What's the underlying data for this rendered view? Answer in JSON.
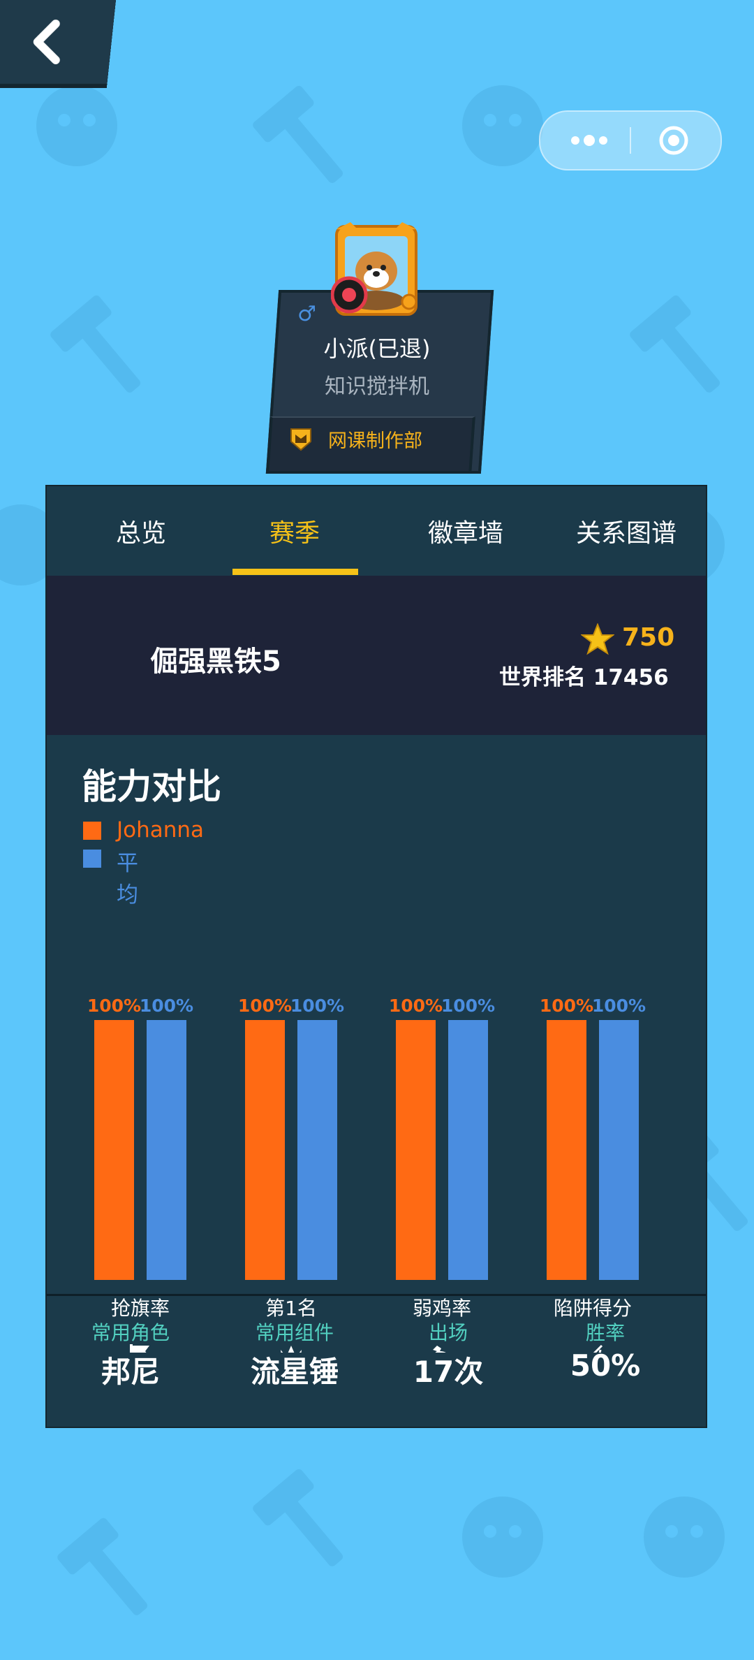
{
  "profile": {
    "name": "小派(已退)",
    "title": "知识搅拌机",
    "club": "网课制作部",
    "gender_icon": "♂"
  },
  "tabs": [
    {
      "label": "总览"
    },
    {
      "label": "赛季"
    },
    {
      "label": "徽章墙"
    },
    {
      "label": "关系图谱"
    }
  ],
  "active_tab": 1,
  "rank": {
    "name": "倔强黑铁5",
    "points": "750",
    "world_rank": "世界排名 17456"
  },
  "ability": {
    "title": "能力对比",
    "legend": [
      {
        "label": "Johanna",
        "color": "#ff6a14"
      },
      {
        "label": "平均",
        "color": "#4a8de0"
      }
    ]
  },
  "chart_data": {
    "type": "bar",
    "categories": [
      "抢旗率",
      "第1名",
      "弱鸡率",
      "陷阱得分"
    ],
    "series": [
      {
        "name": "Johanna",
        "values": [
          100,
          100,
          100,
          100
        ],
        "color": "#ff6a14"
      },
      {
        "name": "平均",
        "values": [
          100,
          100,
          100,
          100
        ],
        "color": "#4a8de0"
      }
    ],
    "value_labels": [
      [
        "100%",
        "100%"
      ],
      [
        "100%",
        "100%"
      ],
      [
        "100%",
        "100%"
      ],
      [
        "100%",
        "100%"
      ]
    ],
    "ylim": [
      0,
      100
    ],
    "icons": [
      "flag-icon",
      "crown-icon",
      "chicken-icon",
      "trap-icon"
    ]
  },
  "stats": [
    {
      "label": "常用角色",
      "value": "邦尼"
    },
    {
      "label": "常用组件",
      "value": "流星锤"
    },
    {
      "label": "出场",
      "value": "17次"
    },
    {
      "label": "胜率",
      "value": "50%"
    }
  ]
}
